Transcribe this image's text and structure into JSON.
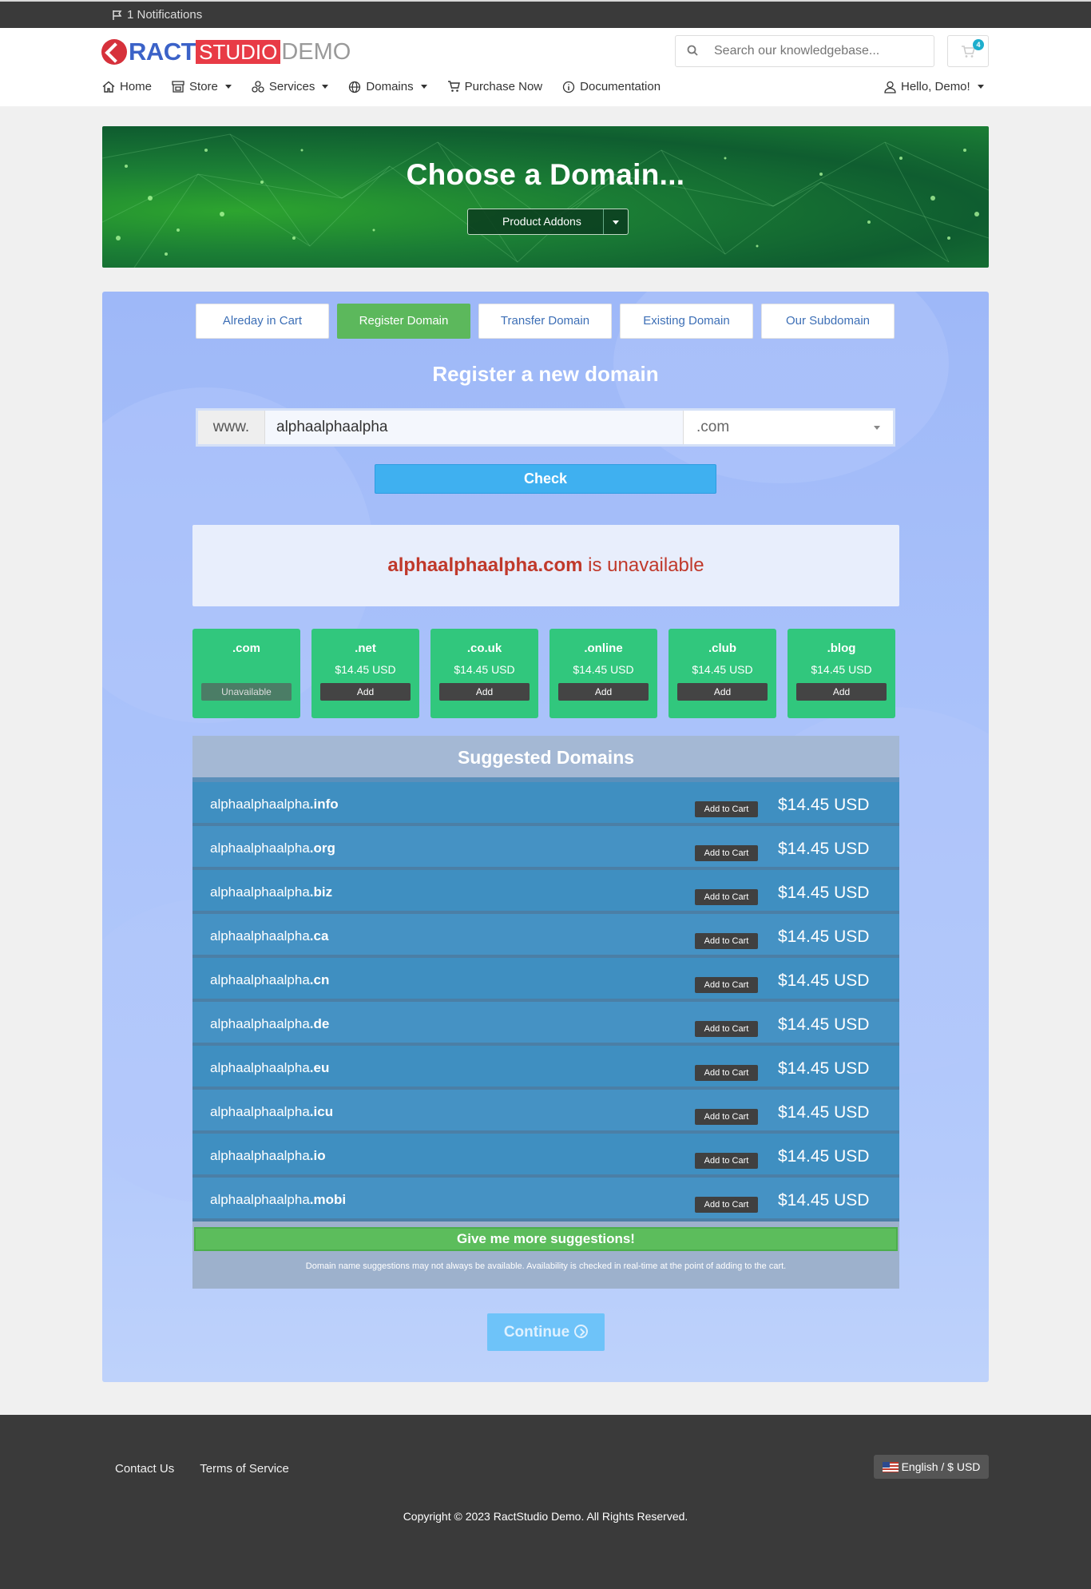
{
  "topbar": {
    "notifications": "1 Notifications"
  },
  "brand": {
    "part1": "RACT",
    "part2": "STUDIO",
    "part3": "DEMO"
  },
  "search": {
    "placeholder": "Search our knowledgebase..."
  },
  "cart": {
    "count": "4"
  },
  "nav": {
    "items": [
      {
        "label": "Home",
        "icon": "home-icon",
        "dropdown": false
      },
      {
        "label": "Store",
        "icon": "store-icon",
        "dropdown": true
      },
      {
        "label": "Services",
        "icon": "services-icon",
        "dropdown": true
      },
      {
        "label": "Domains",
        "icon": "globe-icon",
        "dropdown": true
      },
      {
        "label": "Purchase Now",
        "icon": "cart-icon",
        "dropdown": false
      },
      {
        "label": "Documentation",
        "icon": "info-icon",
        "dropdown": false
      }
    ],
    "user": "Hello, Demo!"
  },
  "hero": {
    "title": "Choose a Domain...",
    "dropdown": "Product Addons"
  },
  "tabs": [
    "Alreday in Cart",
    "Register Domain",
    "Transfer Domain",
    "Existing Domain",
    "Our Subdomain"
  ],
  "active_tab": "Register Domain",
  "register": {
    "title": "Register a new domain",
    "prefix": "www.",
    "value": "alphaalphaalpha",
    "tld": ".com",
    "check_label": "Check"
  },
  "result": {
    "domain": "alphaalphaalpha.com",
    "status": "is unavailable"
  },
  "tld_cards": [
    {
      "name": ".com",
      "price": "",
      "action": "Unavailable"
    },
    {
      "name": ".net",
      "price": "$14.45 USD",
      "action": "Add"
    },
    {
      "name": ".co.uk",
      "price": "$14.45 USD",
      "action": "Add"
    },
    {
      "name": ".online",
      "price": "$14.45 USD",
      "action": "Add"
    },
    {
      "name": ".club",
      "price": "$14.45 USD",
      "action": "Add"
    },
    {
      "name": ".blog",
      "price": "$14.45 USD",
      "action": "Add"
    }
  ],
  "suggested": {
    "title": "Suggested Domains",
    "base": "alphaalphaalpha",
    "add_label": "Add to Cart",
    "rows": [
      {
        "ext": ".info",
        "price": "$14.45 USD"
      },
      {
        "ext": ".org",
        "price": "$14.45 USD"
      },
      {
        "ext": ".biz",
        "price": "$14.45 USD"
      },
      {
        "ext": ".ca",
        "price": "$14.45 USD"
      },
      {
        "ext": ".cn",
        "price": "$14.45 USD"
      },
      {
        "ext": ".de",
        "price": "$14.45 USD"
      },
      {
        "ext": ".eu",
        "price": "$14.45 USD"
      },
      {
        "ext": ".icu",
        "price": "$14.45 USD"
      },
      {
        "ext": ".io",
        "price": "$14.45 USD"
      },
      {
        "ext": ".mobi",
        "price": "$14.45 USD"
      }
    ],
    "more_label": "Give me more suggestions!",
    "disclaimer": "Domain name suggestions may not always be available. Availability is checked in real-time at the point of adding to the cart."
  },
  "continue_label": "Continue",
  "footer": {
    "links": [
      "Contact Us",
      "Terms of Service"
    ],
    "language": "English / $ USD",
    "copyright": "Copyright © 2023 RactStudio Demo. All Rights Reserved."
  },
  "colors": {
    "accent_green": "#5cb85c",
    "brand_blue": "#3b62c8",
    "brand_red": "#e83b46",
    "check_blue": "#3fb0f0",
    "unavailable_red": "#c0392b"
  }
}
